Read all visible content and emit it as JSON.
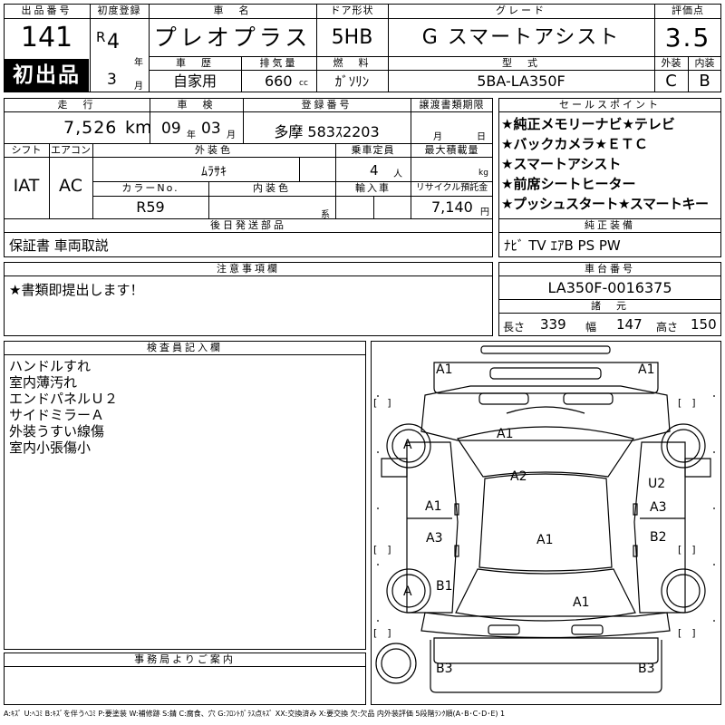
{
  "header": {
    "lot_label": "出品番号",
    "lot_value": "141",
    "first_listing": "初出品",
    "first_reg_label": "初度登録",
    "era": "R",
    "year_value": "4",
    "year_unit": "年",
    "month_value": "3",
    "month_unit": "月",
    "name_label": "車　名",
    "name_value": "プレオプラス",
    "door_label": "ドア形状",
    "door_value": "5HB",
    "grade_label": "グレード",
    "grade_value": "G スマートアシスト",
    "score_label": "評価点",
    "score_value": "3.5",
    "history_label": "車　歴",
    "history_value": "自家用",
    "displacement_label": "排気量",
    "displacement_value": "660",
    "displacement_unit": "cc",
    "fuel_label": "燃　料",
    "fuel_value": "ｶﾞｿﾘﾝ",
    "model_label": "型　式",
    "model_value": "5BA-LA350F",
    "exterior_label": "外装",
    "exterior_value": "C",
    "interior_label": "内装",
    "interior_value": "B"
  },
  "details": {
    "mileage_label": "走　行",
    "mileage_value": "7,526",
    "mileage_unit": "km",
    "inspection_label": "車　検",
    "inspection_year": "09",
    "inspection_year_unit": "年",
    "inspection_month": "03",
    "inspection_month_unit": "月",
    "reg_number_label": "登録番号",
    "reg_number_value": "多摩 583ｽ2203",
    "transfer_docs_label": "譲渡書類期限",
    "transfer_month_unit": "月",
    "transfer_day_unit": "日",
    "shift_label": "シフト",
    "shift_value": "IAT",
    "ac_label": "エアコン",
    "ac_value": "AC",
    "exterior_color_label": "外装色",
    "exterior_color_value": "ﾑﾗｻｷ",
    "capacity_label": "乗車定員",
    "capacity_value": "4",
    "capacity_unit": "人",
    "max_load_label": "最大積載量",
    "max_load_unit": "kg",
    "color_no_label": "カラーNo.",
    "color_no_value": "R59",
    "interior_color_label": "内装色",
    "interior_color_unit": "系",
    "import_label": "輸入車",
    "recycle_label": "リサイクル預託金",
    "recycle_value": "7,140",
    "recycle_unit": "円",
    "later_parts_label": "後日発送部品",
    "later_parts_value": "保証書 車両取説"
  },
  "sales_points": {
    "label": "セールスポイント",
    "items": [
      "★純正メモリーナビ★テレビ",
      "★バックカメラ★ＥＴＣ",
      "★スマートアシスト",
      "★前席シートヒーター",
      "★プッシュスタート★スマートキー"
    ]
  },
  "genuine_equipment": {
    "label": "純正装備",
    "value": "ﾅﾋﾞ TV ｴｱB PS PW"
  },
  "notes": {
    "label": "注意事項欄",
    "value": "★書類即提出します！"
  },
  "chassis": {
    "label": "車台番号",
    "value": "LA350F-0016375",
    "dims_label": "諸　元",
    "length_label": "長さ",
    "length_value": "339",
    "width_label": "幅",
    "width_value": "147",
    "height_label": "高さ",
    "height_value": "150"
  },
  "inspector": {
    "label": "検査員記入欄",
    "remarks": [
      "ハンドルすれ",
      "室内薄汚れ",
      "エンドパネルＵ２",
      "サイドミラーＡ",
      "外装うすい線傷",
      "室内小張傷小"
    ]
  },
  "office": {
    "label": "事務局よりご案内"
  },
  "diagram": {
    "bracket": "[　]",
    "marks": [
      "A1",
      "A1",
      "A1",
      "A2",
      "A1",
      "U2",
      "A3",
      "A3",
      "A1",
      "B2",
      "B1",
      "A1",
      "B3",
      "B3",
      "A",
      "A"
    ]
  },
  "legend": "A:ｷｽﾞ U:ﾍｺﾐ B:ｷｽﾞを伴うﾍｺﾐ P:要塗装 W:補修跡 S:錆 C:腐食、穴 G:ﾌﾛﾝﾄｶﾞﾗｽ点ｷｽﾞ XX:交換済み X:要交換 欠:欠品 内外装評価 5段階ﾗﾝｸ順(A･B･C･D･E) 1"
}
